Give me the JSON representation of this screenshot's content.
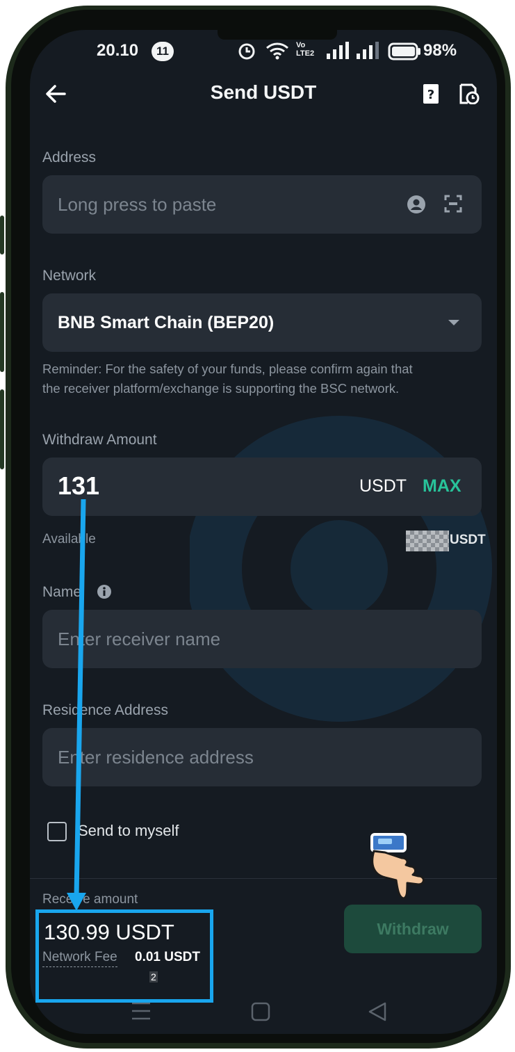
{
  "status_bar": {
    "time": "20.10",
    "notification_count": "11",
    "battery": "98%"
  },
  "header": {
    "title": "Send USDT"
  },
  "address": {
    "label": "Address",
    "placeholder": "Long press to paste"
  },
  "network": {
    "label": "Network",
    "selected": "BNB Smart Chain (BEP20)",
    "reminder_line1": "Reminder: For the safety of your funds, please confirm again that",
    "reminder_line2": "the receiver platform/exchange is supporting the BSC network."
  },
  "withdraw_amount": {
    "label": "Withdraw Amount",
    "value": "131",
    "currency": "USDT",
    "max_label": "MAX",
    "available_label": "Available",
    "available_currency": "USDT"
  },
  "name": {
    "label": "Name",
    "placeholder": "Enter receiver name"
  },
  "residence": {
    "label": "Residence Address",
    "placeholder": "Enter residence address"
  },
  "send_to_myself": {
    "label": "Send to myself",
    "checked": false
  },
  "footer": {
    "receive_label": "Receive amount",
    "receive_value": "130.99 USDT",
    "fee_label": "Network Fee",
    "fee_value": "0.01 USDT",
    "fee_note": "2",
    "withdraw_label": "Withdraw"
  },
  "colors": {
    "accent_max": "#28c39a",
    "annotation": "#19a6ee",
    "background": "#151b22",
    "field": "#262d36"
  }
}
